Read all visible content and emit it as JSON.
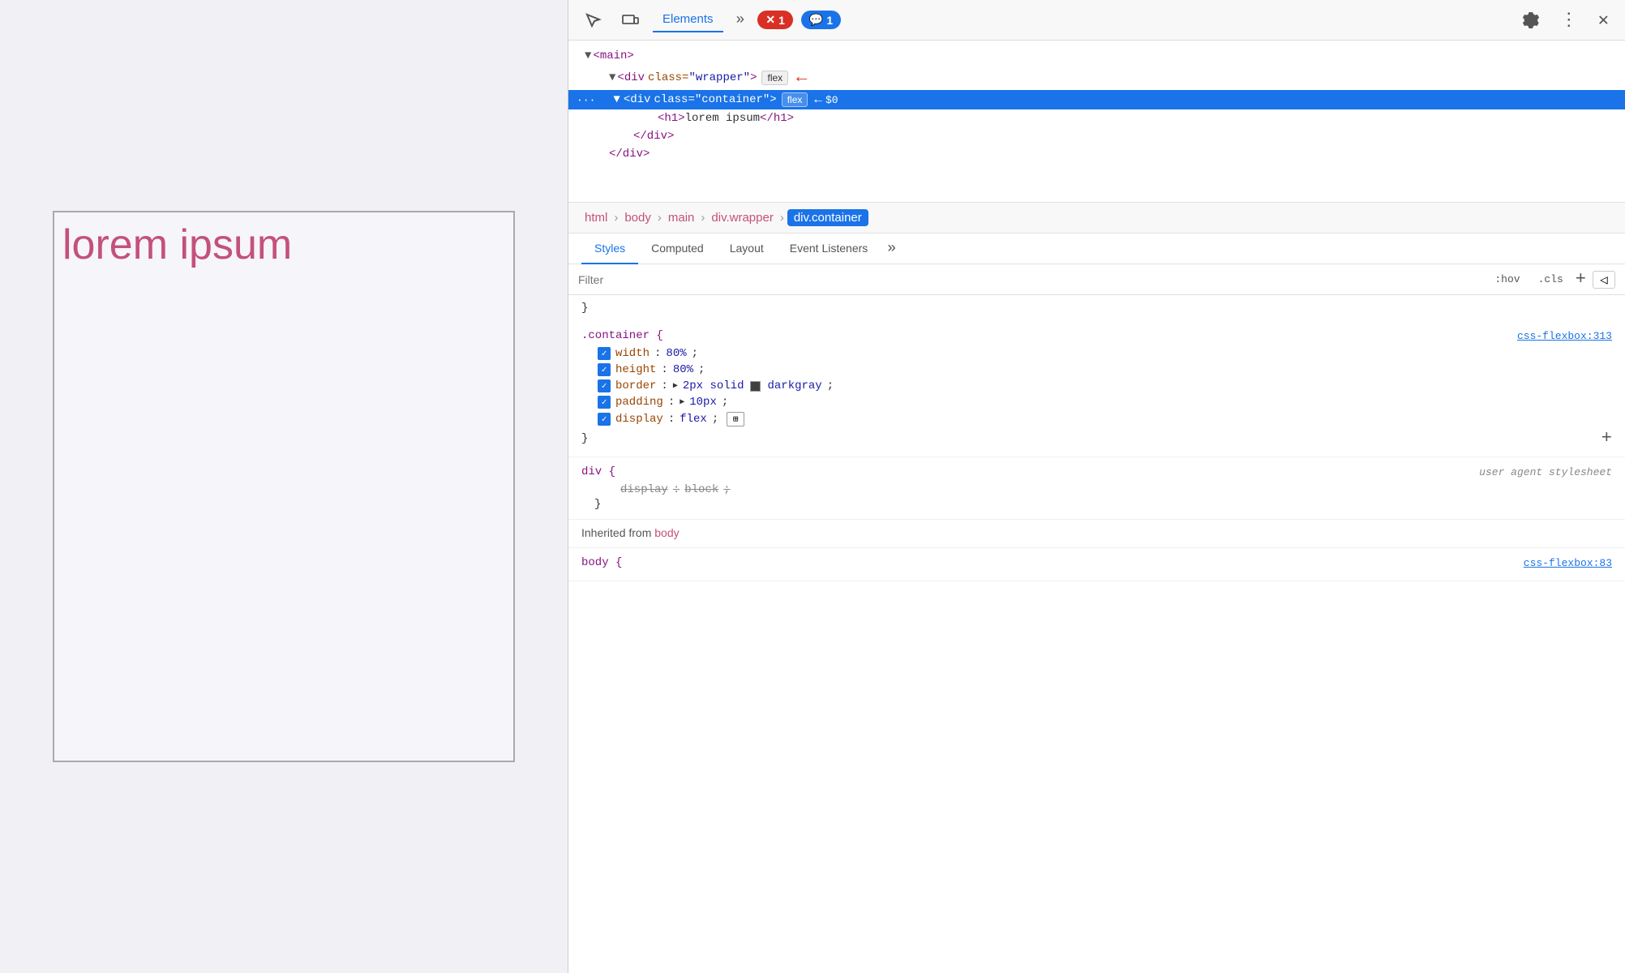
{
  "viewport": {
    "lorem_text": "lorem ipsum"
  },
  "devtools": {
    "toolbar": {
      "inspect_icon": "⊹",
      "device_icon": "▭",
      "tab_elements": "Elements",
      "more_tabs": "»",
      "badge_errors": "1",
      "badge_messages": "1",
      "settings_icon": "⚙",
      "more_icon": "⋮",
      "close_icon": "✕"
    },
    "html_tree": {
      "main_tag": "<main>",
      "wrapper_tag": "<div class=\"wrapper\">",
      "container_tag": "<div class=\"container\">",
      "h1_tag": "<h1>lorem ipsum</h1>",
      "div_close": "</div>",
      "div_close2": "</div>",
      "flex_label": "flex"
    },
    "breadcrumb": {
      "items": [
        "html",
        "body",
        "main",
        "div.wrapper",
        "div.container"
      ]
    },
    "style_tabs": {
      "tabs": [
        "Styles",
        "Computed",
        "Layout",
        "Event Listeners"
      ],
      "more": "»",
      "active": "Styles"
    },
    "filter_bar": {
      "placeholder": "Filter",
      "hov_btn": ":hov",
      "cls_btn": ".cls",
      "add_btn": "+",
      "rtl_btn": "◁"
    },
    "css_rules": {
      "rule1": {
        "selector": ".container {",
        "source": "css-flexbox:313",
        "properties": [
          {
            "name": "width",
            "value": "80%",
            "checked": true
          },
          {
            "name": "height",
            "value": "80%",
            "checked": true
          },
          {
            "name": "border",
            "value": "2px solid",
            "color": "#404040",
            "color_name": "darkgray",
            "checked": true,
            "has_color": true
          },
          {
            "name": "padding",
            "value": "10px",
            "checked": true,
            "has_triangle": true
          },
          {
            "name": "display",
            "value": "flex",
            "checked": true,
            "has_flex_icon": true
          }
        ],
        "close": "}"
      },
      "rule2": {
        "selector": "div {",
        "source_label": "user agent stylesheet",
        "properties": [
          {
            "name": "display",
            "value": "block",
            "strikethrough": true
          }
        ],
        "close": "}"
      },
      "inherited": {
        "label": "Inherited from",
        "from": "body"
      },
      "rule3": {
        "selector": "body {",
        "source": "css-flexbox:83"
      }
    }
  }
}
